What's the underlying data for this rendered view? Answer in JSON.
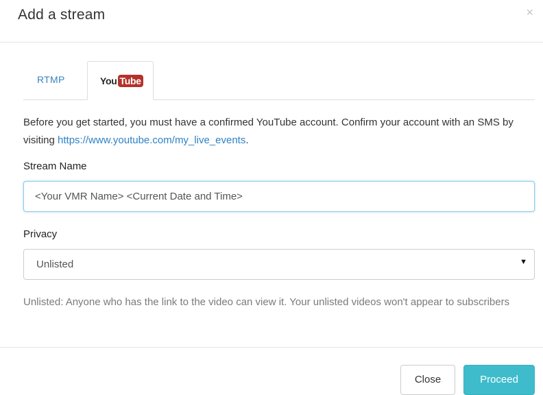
{
  "dialog": {
    "title": "Add a stream",
    "close_symbol": "×",
    "close_icon": "close-icon"
  },
  "tabs": [
    {
      "label": "RTMP",
      "active": false
    },
    {
      "label": "YouTube",
      "logo_you": "You",
      "logo_tube": "Tube",
      "active": true
    }
  ],
  "intro": {
    "text": "Before you get started, you must have a confirmed YouTube account. Confirm your account with an SMS by visiting ",
    "link": "https://www.youtube.com/my_live_events",
    "suffix": "."
  },
  "stream_name": {
    "label": "Stream Name",
    "value": "<Your VMR Name> <Current Date and Time>"
  },
  "privacy": {
    "label": "Privacy",
    "selected": "Unlisted",
    "caret": "▼",
    "help": "Unlisted: Anyone who has the link to the video can view it. Your unlisted videos won't appear to subscribers"
  },
  "footer": {
    "close_label": "Close",
    "proceed_label": "Proceed"
  },
  "colors": {
    "link": "#2e82c6",
    "primary_button": "#3fbccb",
    "youtube_red": "#b3322a",
    "focus_border": "#8fcbe3"
  }
}
